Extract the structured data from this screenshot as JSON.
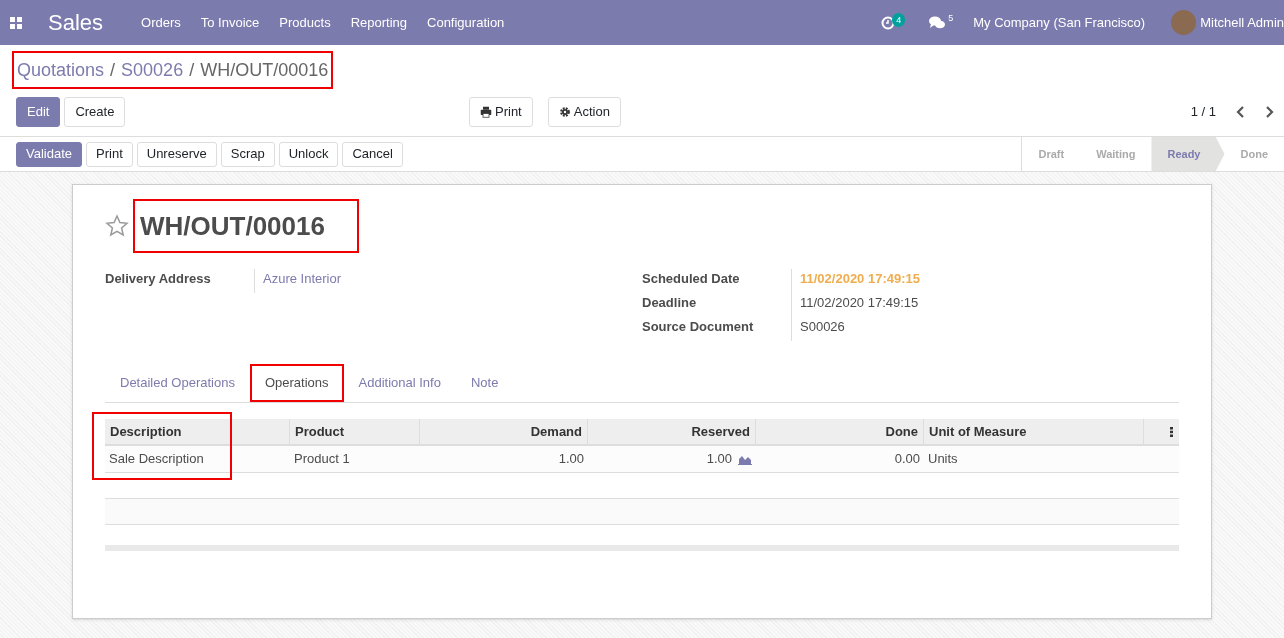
{
  "navbar": {
    "app": "Sales",
    "menu": [
      "Orders",
      "To Invoice",
      "Products",
      "Reporting",
      "Configuration"
    ],
    "activity_count": "4",
    "message_count": "5",
    "company": "My Company (San Francisco)",
    "user": "Mitchell Admin"
  },
  "breadcrumb": {
    "highlighted": true,
    "separator": "/",
    "items": [
      {
        "label": "Quotations",
        "link": true
      },
      {
        "label": "S00026",
        "link": true
      },
      {
        "label": "WH/OUT/00016",
        "link": false
      }
    ]
  },
  "control_buttons": [
    {
      "label": "Edit",
      "primary": true
    },
    {
      "label": "Create",
      "primary": false
    }
  ],
  "action_buttons": [
    {
      "label": "Print",
      "kind": "print"
    },
    {
      "label": "Action",
      "kind": "gear"
    }
  ],
  "pager": "1 / 1",
  "header_buttons": [
    {
      "label": "Validate",
      "primary": true
    },
    {
      "label": "Print",
      "primary": false
    },
    {
      "label": "Unreserve",
      "primary": false
    },
    {
      "label": "Scrap",
      "primary": false
    },
    {
      "label": "Unlock",
      "primary": false
    },
    {
      "label": "Cancel",
      "primary": false
    }
  ],
  "stages": [
    {
      "label": "Draft",
      "selected": false
    },
    {
      "label": "Waiting",
      "selected": false
    },
    {
      "label": "Ready",
      "selected": true
    },
    {
      "label": "Done",
      "selected": false
    }
  ],
  "record": {
    "title": "WH/OUT/00016",
    "favorite": false,
    "title_highlighted": true,
    "left_fields": [
      {
        "label": "Delivery Address",
        "value": "Azure Interior",
        "kind": "link"
      }
    ],
    "right_fields": [
      {
        "label": "Scheduled Date",
        "value": "11/02/2020 17:49:15",
        "kind": "warning"
      },
      {
        "label": "Deadline",
        "value": "11/02/2020 17:49:15",
        "kind": "plain"
      },
      {
        "label": "Source Document",
        "value": "S00026",
        "kind": "plain"
      }
    ]
  },
  "tabs": [
    {
      "label": "Detailed Operations",
      "selected": false,
      "highlighted": false
    },
    {
      "label": "Operations",
      "selected": true,
      "highlighted": true
    },
    {
      "label": "Additional Info",
      "selected": false,
      "highlighted": false
    },
    {
      "label": "Note",
      "selected": false,
      "highlighted": false
    }
  ],
  "table": {
    "columns": [
      {
        "label": "Description",
        "highlighted": true
      },
      {
        "label": "Product",
        "highlighted": false
      },
      {
        "label": "Demand",
        "highlighted": false
      },
      {
        "label": "Reserved",
        "highlighted": false
      },
      {
        "label": "Done",
        "highlighted": false
      },
      {
        "label": "Unit of Measure",
        "highlighted": false
      }
    ],
    "rows": [
      [
        "Sale Description",
        "Product 1",
        "1.00",
        "1.00",
        "0.00",
        "Units"
      ]
    ]
  }
}
